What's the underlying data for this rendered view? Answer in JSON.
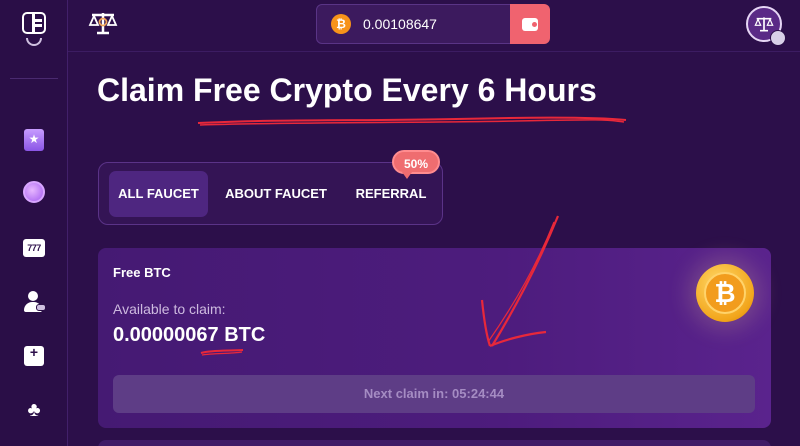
{
  "topbar": {
    "balance": "0.00108647",
    "currency_icon": "bitcoin-icon"
  },
  "page": {
    "title": "Claim Free Crypto Every 6 Hours"
  },
  "tabs": [
    {
      "label": "ALL FAUCET",
      "active": true
    },
    {
      "label": "ABOUT FAUCET",
      "active": false
    },
    {
      "label": "REFERRAL",
      "active": false
    }
  ],
  "referral_badge": "50%",
  "faucet_card": {
    "title": "Free BTC",
    "available_label": "Available to claim:",
    "amount": "0.00000067 BTC",
    "next_claim": "Next claim in: 05:24:44"
  },
  "sidebar": {
    "icons": [
      "sidebar-toggle-icon",
      "star-badge-icon",
      "clock-icon",
      "slot-777-icon",
      "user-card-icon",
      "gift-box-icon",
      "cards-suits-icon"
    ],
    "slot_text": "777"
  },
  "colors": {
    "background": "#2c0f4a",
    "accent": "#f0636f",
    "bitcoin": "#f7931a",
    "annotation": "#e8283a"
  }
}
